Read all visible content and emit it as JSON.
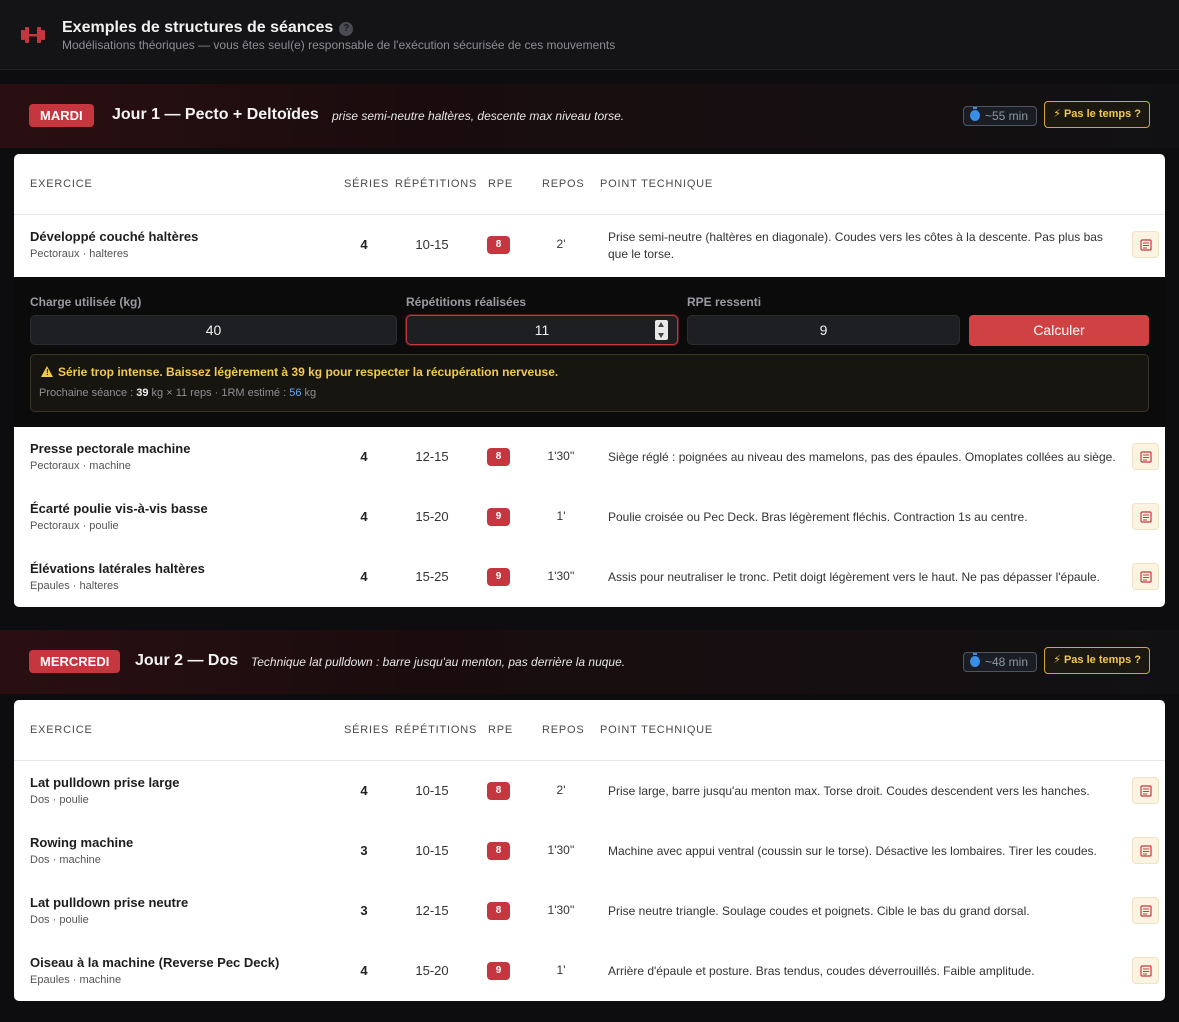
{
  "header": {
    "title": "Exemples de structures de séances",
    "info": "?",
    "subtitle": "Modélisations théoriques — vous êtes seul(e) responsable de l'exécution sécurisée de ces mouvements"
  },
  "columns": {
    "exercise": "EXERCICE",
    "series": "SÉRIES",
    "reps": "RÉPÉTITIONS",
    "rpe": "RPE",
    "rest": "REPOS",
    "tech": "POINT TECHNIQUE"
  },
  "day1": {
    "badge": "MARDI",
    "title": "Jour 1 — Pecto + Deltoïdes",
    "note": "prise semi-neutre haltères, descente max niveau torse.",
    "duration": "~55 min",
    "notime": "⚡ Pas le temps ?",
    "rows": [
      {
        "name": "Développé couché haltères",
        "sub": "Pectoraux · halteres",
        "series": "4",
        "reps": "10-15",
        "rpe": "8",
        "rest": "2'",
        "tech": "Prise semi-neutre (haltères en diagonale). Coudes vers les côtes à la descente. Pas plus bas que le torse."
      },
      {
        "name": "Presse pectorale machine",
        "sub": "Pectoraux · machine",
        "series": "4",
        "reps": "12-15",
        "rpe": "8",
        "rest": "1'30''",
        "tech": "Siège réglé : poignées au niveau des mamelons, pas des épaules. Omoplates collées au siège."
      },
      {
        "name": "Écarté poulie vis-à-vis basse",
        "sub": "Pectoraux · poulie",
        "series": "4",
        "reps": "15-20",
        "rpe": "9",
        "rest": "1'",
        "tech": "Poulie croisée ou Pec Deck. Bras légèrement fléchis. Contraction 1s au centre."
      },
      {
        "name": "Élévations latérales haltères",
        "sub": "Epaules · halteres",
        "series": "4",
        "reps": "15-25",
        "rpe": "9",
        "rest": "1'30''",
        "tech": "Assis pour neutraliser le tronc. Petit doigt légèrement vers le haut. Ne pas dépasser l'épaule."
      }
    ]
  },
  "calculator": {
    "charge_label": "Charge utilisée (kg)",
    "charge_value": "40",
    "reps_label": "Répétitions réalisées",
    "reps_value": "11",
    "rpe_label": "RPE ressenti",
    "rpe_value": "9",
    "button": "Calculer",
    "alert": "Série trop intense. Baissez légèrement à 39 kg pour respecter la récupération nerveuse.",
    "next_prefix": "Prochaine séance : ",
    "next_load": "39",
    "next_mid": " kg × 11 reps · 1RM estimé : ",
    "next_1rm": "56",
    "next_unit": " kg"
  },
  "day2": {
    "badge": "MERCREDI",
    "title": "Jour 2 — Dos",
    "note": "Technique lat pulldown : barre jusqu'au menton, pas derrière la nuque.",
    "duration": "~48 min",
    "notime": "⚡ Pas le temps ?",
    "rows": [
      {
        "name": "Lat pulldown prise large",
        "sub": "Dos · poulie",
        "series": "4",
        "reps": "10-15",
        "rpe": "8",
        "rest": "2'",
        "tech": "Prise large, barre jusqu'au menton max. Torse droit. Coudes descendent vers les hanches."
      },
      {
        "name": "Rowing machine",
        "sub": "Dos · machine",
        "series": "3",
        "reps": "10-15",
        "rpe": "8",
        "rest": "1'30''",
        "tech": "Machine avec appui ventral (coussin sur le torse). Désactive les lombaires. Tirer les coudes."
      },
      {
        "name": "Lat pulldown prise neutre",
        "sub": "Dos · poulie",
        "series": "3",
        "reps": "12-15",
        "rpe": "8",
        "rest": "1'30''",
        "tech": "Prise neutre triangle. Soulage coudes et poignets. Cible le bas du grand dorsal."
      },
      {
        "name": "Oiseau à la machine (Reverse Pec Deck)",
        "sub": "Epaules · machine",
        "series": "4",
        "reps": "15-20",
        "rpe": "9",
        "rest": "1'",
        "tech": "Arrière d'épaule et posture. Bras tendus, coudes déverrouillés. Faible amplitude."
      }
    ]
  },
  "icons": {
    "logo": "dumbbell-icon",
    "timer": "stopwatch-icon",
    "note": "notepad-icon",
    "alert": "warning-icon"
  },
  "colors": {
    "accent": "#c6363e",
    "warning": "#f2c94c",
    "info": "#3a8ee6"
  }
}
